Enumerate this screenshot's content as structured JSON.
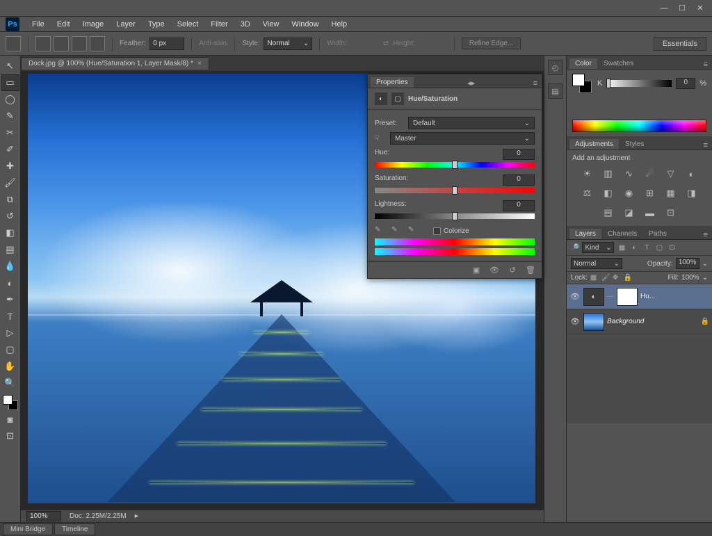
{
  "menubar": [
    "File",
    "Edit",
    "Image",
    "Layer",
    "Type",
    "Select",
    "Filter",
    "3D",
    "View",
    "Window",
    "Help"
  ],
  "optionsbar": {
    "feather_label": "Feather:",
    "feather_value": "0 px",
    "antialias": "Anti-alias",
    "style_label": "Style:",
    "style_value": "Normal",
    "width_label": "Width:",
    "height_label": "Height:",
    "refine": "Refine Edge...",
    "essentials": "Essentials"
  },
  "document": {
    "tab_title": "Dock.jpg @ 100% (Hue/Saturation 1, Layer Mask/8) *"
  },
  "status": {
    "zoom": "100%",
    "doc": "Doc: 2.25M/2.25M"
  },
  "bottom_tabs": [
    "Mini Bridge",
    "Timeline"
  ],
  "color_panel": {
    "tabs": [
      "Color",
      "Swatches"
    ],
    "k_label": "K",
    "k_value": "0",
    "pct": "%"
  },
  "adjustments_panel": {
    "tabs": [
      "Adjustments",
      "Styles"
    ],
    "title": "Add an adjustment"
  },
  "layers_panel": {
    "tabs": [
      "Layers",
      "Channels",
      "Paths"
    ],
    "kind": "Kind",
    "blend_mode": "Normal",
    "opacity_label": "Opacity:",
    "opacity_value": "100%",
    "lock_label": "Lock:",
    "fill_label": "Fill:",
    "fill_value": "100%",
    "layers": [
      {
        "name": "Hu...",
        "type": "adjustment"
      },
      {
        "name": "Background",
        "type": "background"
      }
    ]
  },
  "properties": {
    "panel_title": "Properties",
    "adjustment_name": "Hue/Saturation",
    "preset_label": "Preset:",
    "preset_value": "Default",
    "channel_value": "Master",
    "hue_label": "Hue:",
    "hue_value": "0",
    "saturation_label": "Saturation:",
    "saturation_value": "0",
    "lightness_label": "Lightness:",
    "lightness_value": "0",
    "colorize_label": "Colorize"
  }
}
